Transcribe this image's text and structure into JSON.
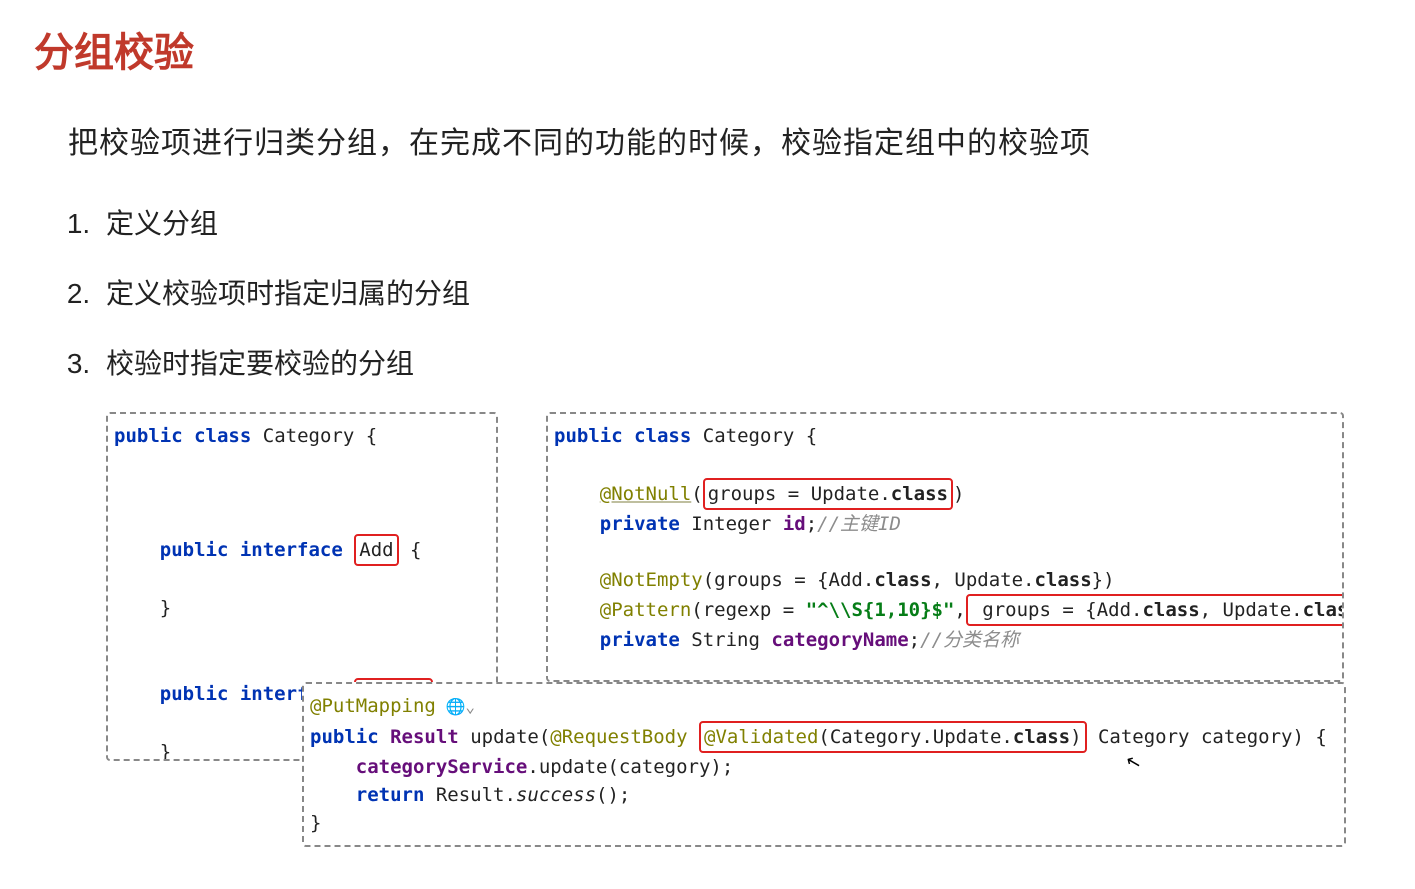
{
  "title": "分组校验",
  "subtitle": "把校验项进行归类分组，在完成不同的功能的时候，校验指定组中的校验项",
  "steps": [
    "定义分组",
    "定义校验项时指定归属的分组",
    "校验时指定要校验的分组"
  ],
  "kw": {
    "public": "public",
    "class": "class",
    "interface": "interface",
    "private": "private",
    "return": "return"
  },
  "names": {
    "Category": "Category",
    "Add": "Add",
    "Update": "Update",
    "Integer": "Integer",
    "String": "String",
    "id_field": "id",
    "categoryName": "categoryName",
    "Result": "Result",
    "update_method": "update",
    "categoryService": "categoryService",
    "category_param": "category",
    "success": "success"
  },
  "ann": {
    "NotNull": "@NotNull",
    "NotEmpty": "@NotEmpty",
    "Pattern": "@Pattern",
    "PutMapping": "@PutMapping",
    "RequestBody": "@RequestBody",
    "Validated": "@Validated"
  },
  "frag": {
    "groups_eq": "groups = ",
    "update_class": "Update.class",
    "add_class": "Add.class",
    "regexp_label": "regexp = ",
    "regexp_val": "\"^\\\\S{1,10}$\"",
    "groups_pair": "groups = {Add.class, Update.class}",
    "groups_pair_bold": "groups = {Add.class, Update.class}",
    "cat_update_class": "Category.Update.class",
    "category_type": "Category",
    "brace_open": "{",
    "brace_close": "}",
    "paren_semi": "();",
    "cmt_id": "//主键ID",
    "cmt_name": "//分类名称",
    "gutter": " 🌐⌄"
  }
}
